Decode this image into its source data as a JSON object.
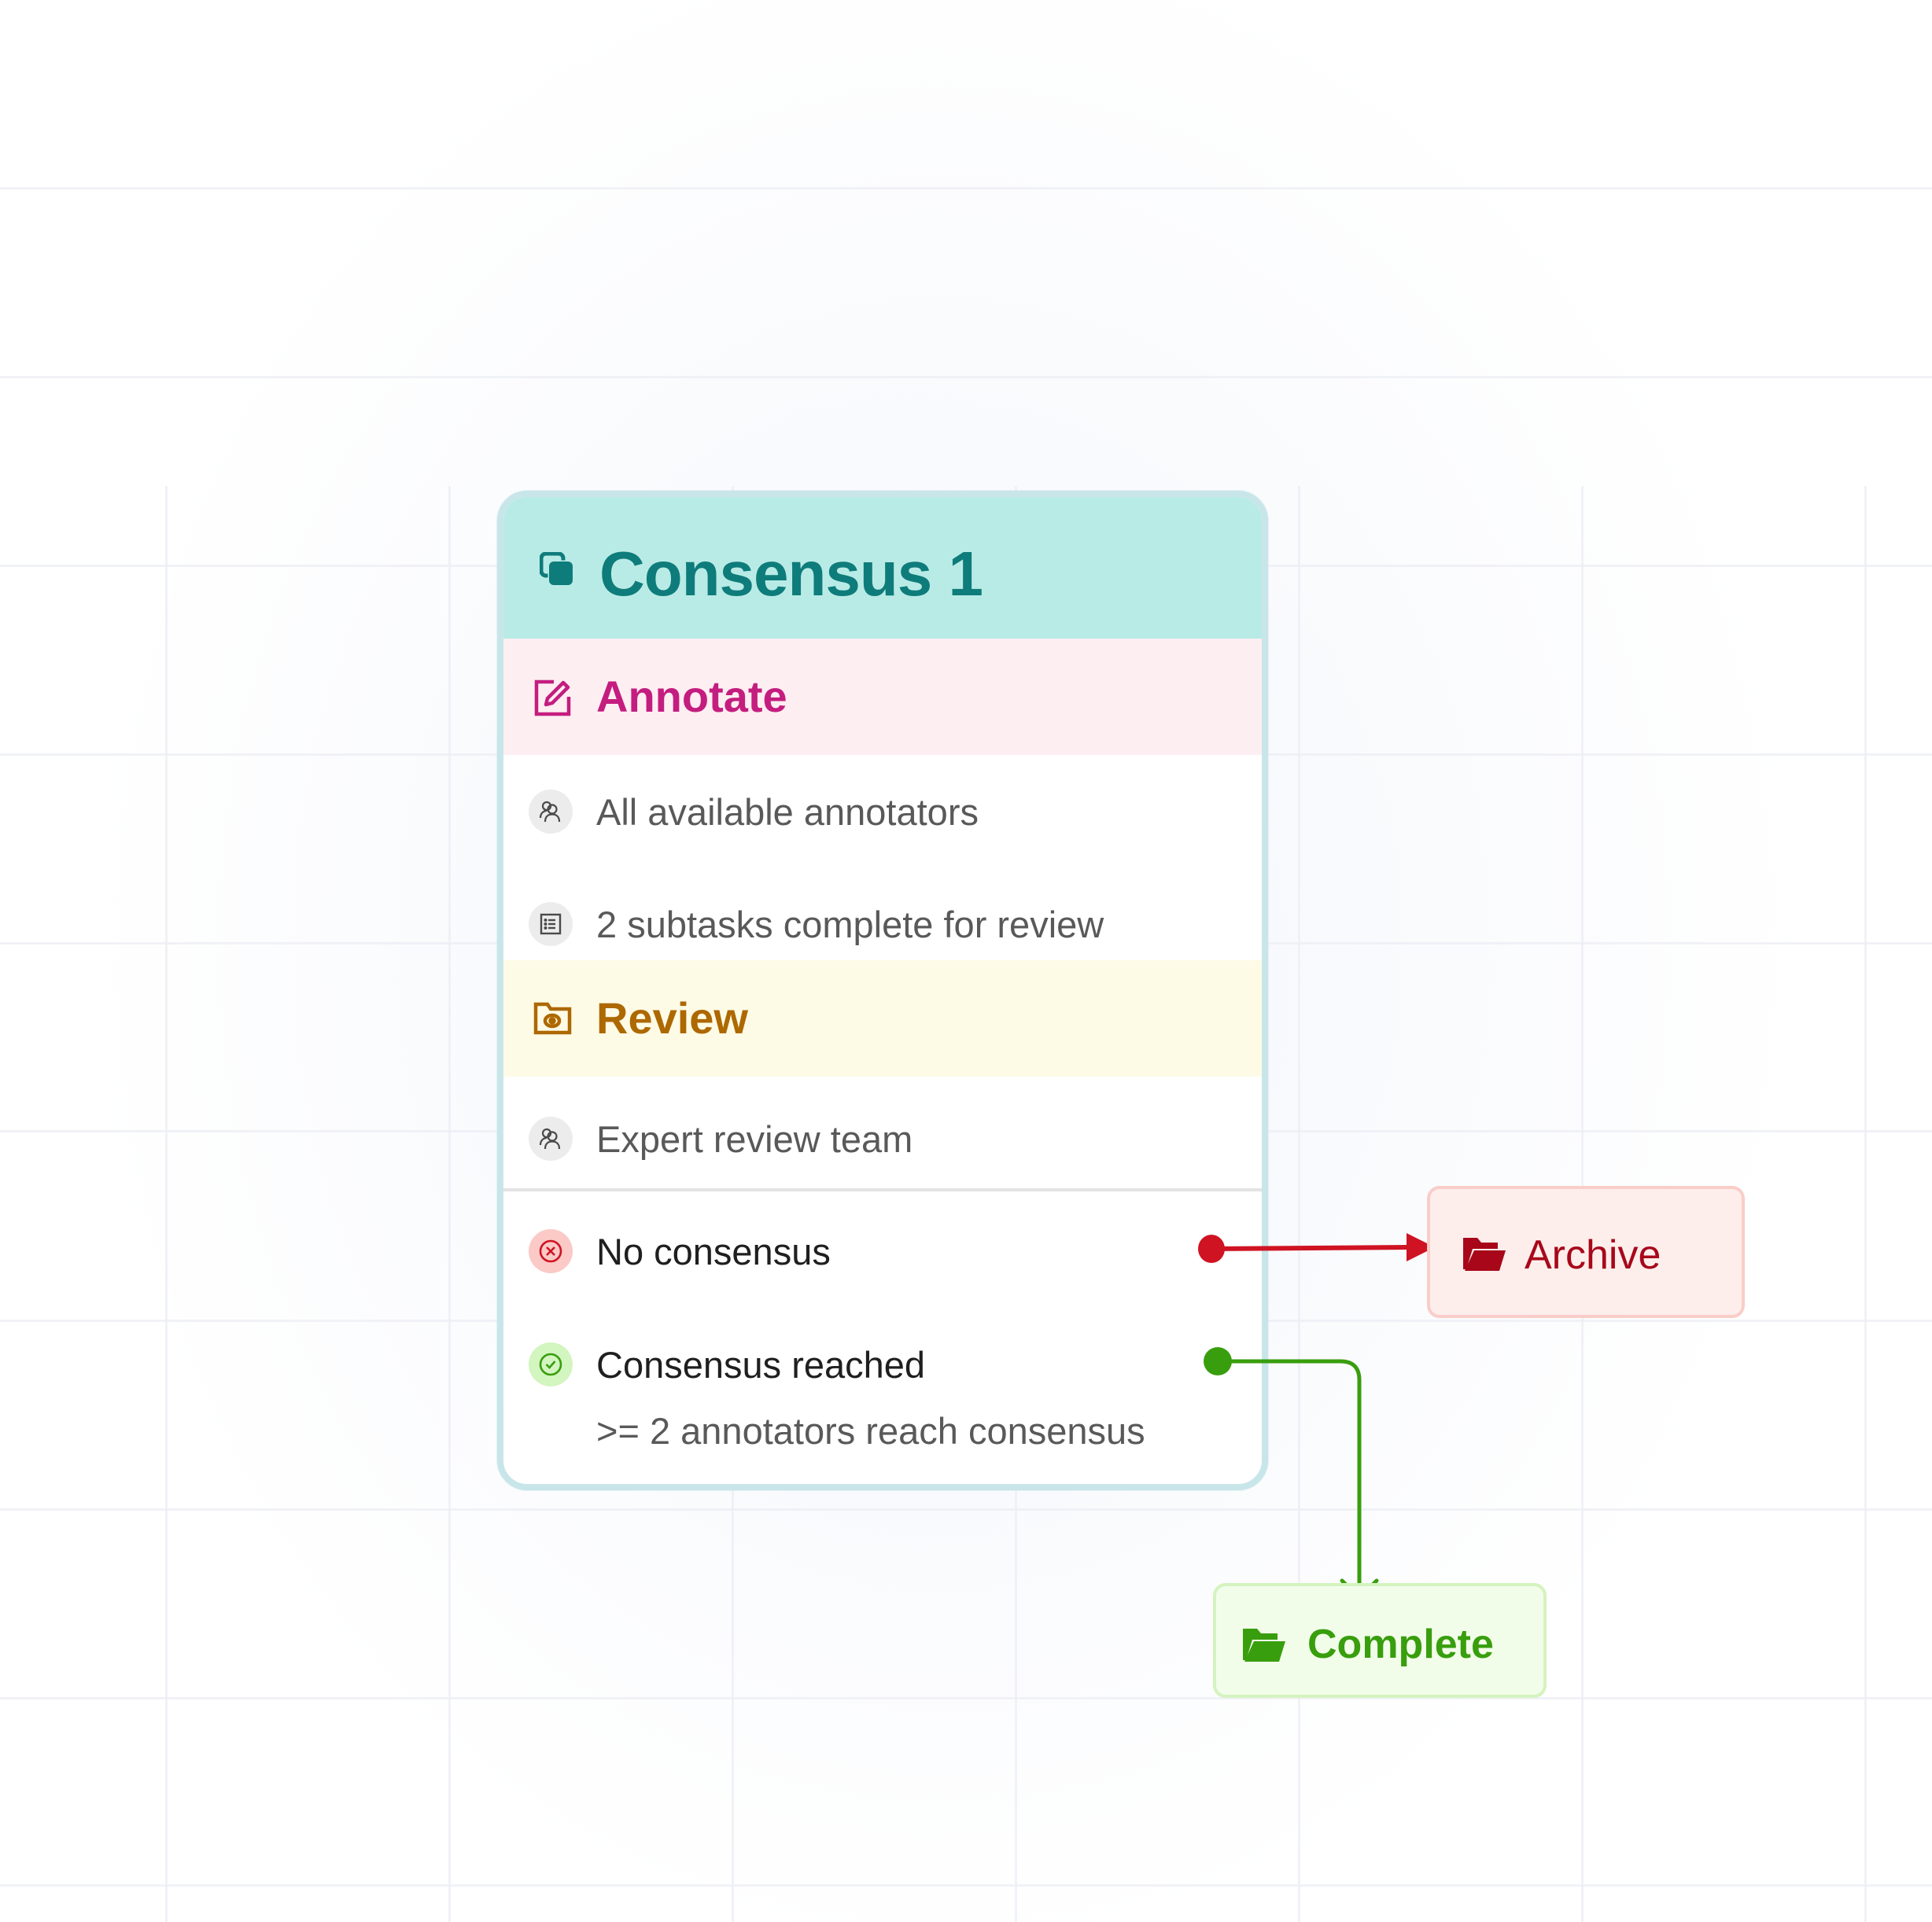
{
  "workflow": {
    "stage": {
      "title": "Consensus 1",
      "icon": "consensus-icon",
      "color": "#0e7c7b",
      "header_bg": "#b9ebe6"
    },
    "annotate": {
      "title": "Annotate",
      "icon": "edit-icon",
      "color": "#c41d7f",
      "rows": [
        {
          "icon": "users-icon",
          "text": "All available annotators"
        },
        {
          "icon": "list-icon",
          "text": "2 subtasks complete for review"
        }
      ]
    },
    "review": {
      "title": "Review",
      "icon": "folder-eye-icon",
      "color": "#ad6800",
      "rows": [
        {
          "icon": "users-icon",
          "text": "Expert review team"
        }
      ]
    },
    "outcomes": [
      {
        "icon": "x-circle-icon",
        "label": "No consensus",
        "color": "#cf1322",
        "target": "Archive"
      },
      {
        "icon": "check-circle-icon",
        "label": "Consensus reached",
        "detail": ">= 2 annotators reach consensus",
        "color": "#389e0d",
        "target": "Complete"
      }
    ],
    "targets": {
      "archive": {
        "label": "Archive",
        "icon": "folder-open-icon",
        "color": "#a8071a"
      },
      "complete": {
        "label": "Complete",
        "icon": "folder-open-icon",
        "color": "#389e0d"
      }
    }
  }
}
